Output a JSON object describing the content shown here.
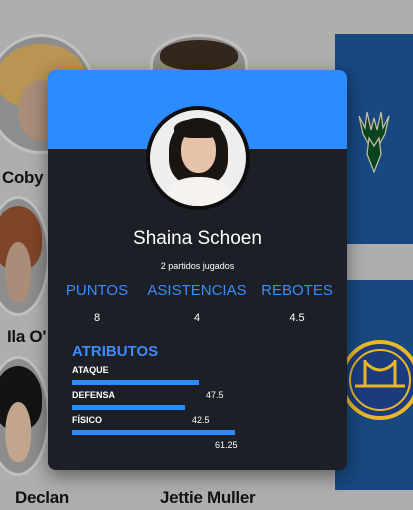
{
  "background": {
    "cards": [
      {
        "name": "Coby S"
      },
      {
        "name": "Ila O'"
      },
      {
        "name": "Declan"
      },
      {
        "name": "Jettie Muller"
      }
    ],
    "teams": [
      {
        "team_icon": "bucks-deer-icon",
        "color": "#00471b"
      },
      {
        "team_icon": "warriors-bridge-icon",
        "color": "#1d428a"
      }
    ]
  },
  "modal": {
    "player_name": "Shaina Schoen",
    "games_played": "2 partidos jugados",
    "stats": [
      {
        "label": "PUNTOS",
        "value": "8"
      },
      {
        "label": "ASISTENCIAS",
        "value": "4"
      },
      {
        "label": "REBOTES",
        "value": "4.5"
      }
    ],
    "attributes_title": "ATRIBUTOS",
    "attributes": [
      {
        "label": "ATAQUE",
        "value": "47.5",
        "level": 47.5
      },
      {
        "label": "DEFENSA",
        "value": "42.5",
        "level": 42.5
      },
      {
        "label": "FÍSICO",
        "value": "61.25",
        "level": 61.25
      }
    ],
    "accent_color": "#2c8cff",
    "card_color": "#1c1f26"
  }
}
